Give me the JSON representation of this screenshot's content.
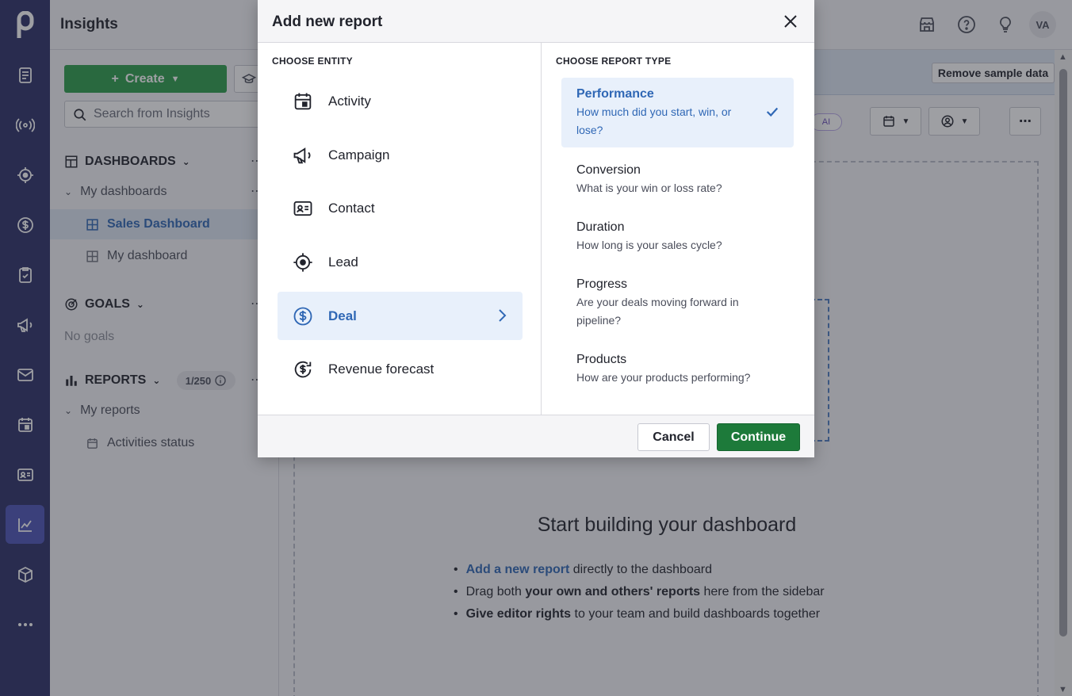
{
  "app": {
    "title": "Insights",
    "avatar_initials": "VA",
    "accent_color": "#2f67b5",
    "brand_color": "#2a2f66"
  },
  "rail": {
    "items": [
      {
        "icon": "pipedrive-logo-icon"
      },
      {
        "icon": "leads-inbox-icon"
      },
      {
        "icon": "radar-icon"
      },
      {
        "icon": "lead-target-icon"
      },
      {
        "icon": "deals-dollar-icon"
      },
      {
        "icon": "tasks-clipboard-icon"
      },
      {
        "icon": "campaigns-megaphone-icon"
      },
      {
        "icon": "mail-icon"
      },
      {
        "icon": "calendar-icon"
      },
      {
        "icon": "contacts-card-icon"
      },
      {
        "icon": "insights-chart-icon",
        "active": true
      },
      {
        "icon": "products-box-icon"
      },
      {
        "icon": "more-dots-icon"
      }
    ]
  },
  "sidebar": {
    "create_label": "Create",
    "search_placeholder": "Search from Insights",
    "dashboards_label": "DASHBOARDS",
    "my_dashboards_label": "My dashboards",
    "dashboards": [
      "Sales Dashboard",
      "My dashboard"
    ],
    "goals_label": "GOALS",
    "no_goals": "No goals",
    "reports_label": "REPORTS",
    "reports_count": "1/250",
    "my_reports_label": "My reports",
    "reports": [
      "Activities status"
    ]
  },
  "main": {
    "remove_sample_label": "Remove sample data",
    "ai_badge": "AI",
    "empty_title": "Start building your dashboard",
    "bullet1_link": "Add a new report",
    "bullet1_rest": " directly to the dashboard",
    "bullet2_pre": "Drag both ",
    "bullet2_bold": "your own and others' reports",
    "bullet2_rest": " here from the sidebar",
    "bullet3_bold": "Give editor rights",
    "bullet3_rest": " to your team and build dashboards together"
  },
  "modal": {
    "title": "Add new report",
    "entity_label": "CHOOSE ENTITY",
    "report_type_label": "CHOOSE REPORT TYPE",
    "entities": [
      {
        "label": "Activity",
        "icon": "calendar-icon"
      },
      {
        "label": "Campaign",
        "icon": "megaphone-icon"
      },
      {
        "label": "Contact",
        "icon": "contact-card-icon"
      },
      {
        "label": "Lead",
        "icon": "target-icon"
      },
      {
        "label": "Deal",
        "icon": "dollar-circle-icon",
        "selected": true
      },
      {
        "label": "Revenue forecast",
        "icon": "revenue-forecast-icon"
      }
    ],
    "report_types": [
      {
        "name": "Performance",
        "desc": "How much did you start, win, or lose?",
        "selected": true
      },
      {
        "name": "Conversion",
        "desc": "What is your win or loss rate?"
      },
      {
        "name": "Duration",
        "desc": "How long is your sales cycle?"
      },
      {
        "name": "Progress",
        "desc": "Are your deals moving forward in pipeline?"
      },
      {
        "name": "Products",
        "desc": "How are your products performing?"
      }
    ],
    "cancel_label": "Cancel",
    "continue_label": "Continue"
  }
}
